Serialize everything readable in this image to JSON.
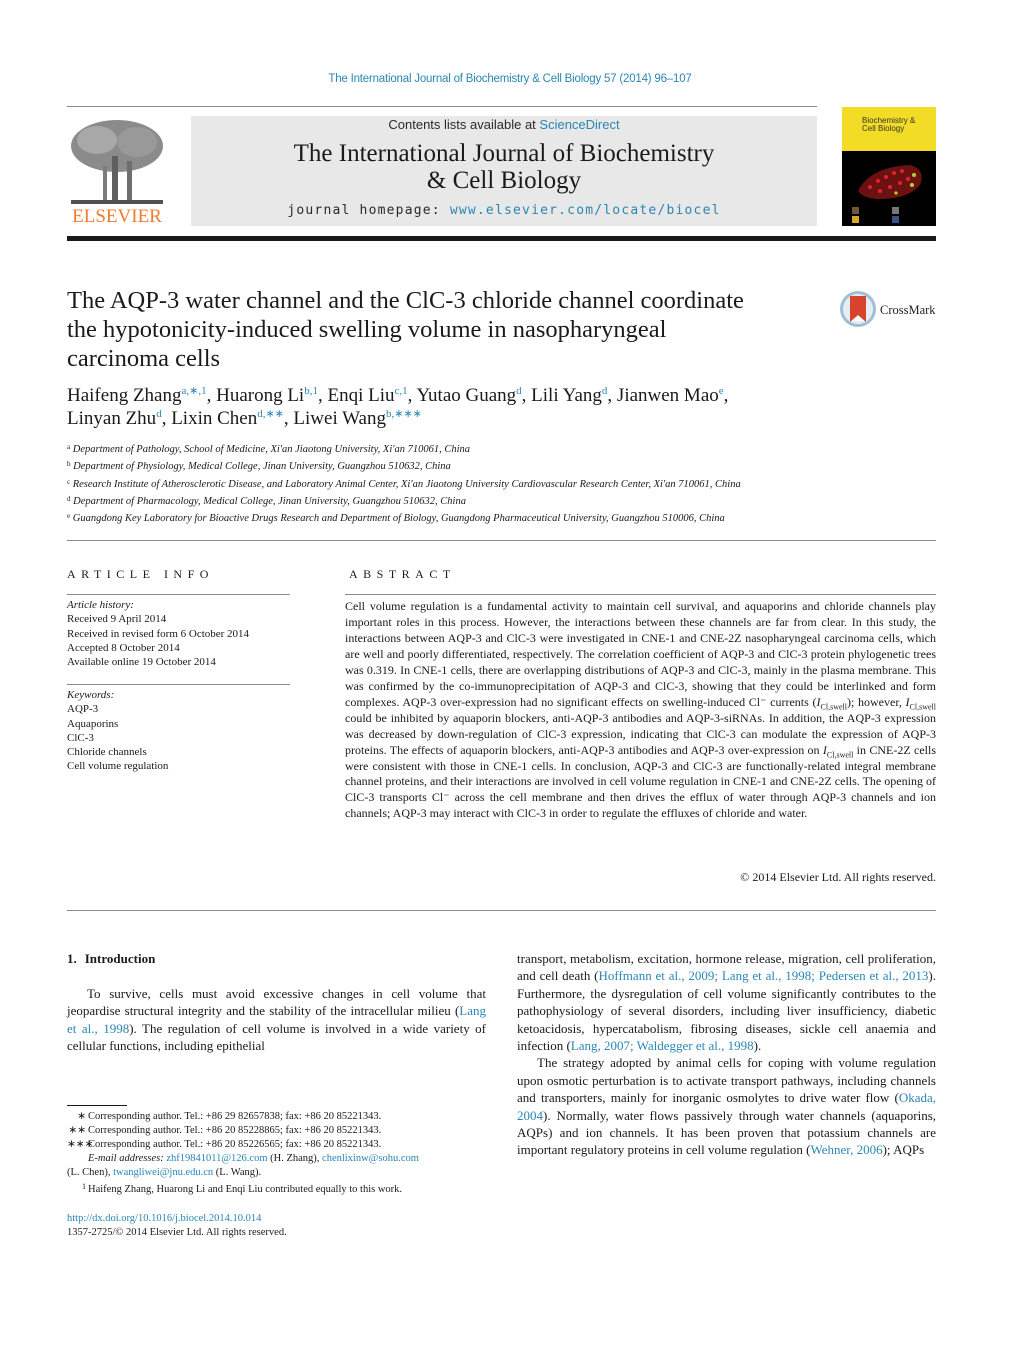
{
  "running_head": "The International Journal of Biochemistry & Cell Biology 57 (2014) 96–107",
  "publisher": {
    "logo_icon": "elsevier-tree-icon",
    "name": "ELSEVIER",
    "color": "#f07c2a"
  },
  "masthead": {
    "contents_prefix": "Contents lists available at ",
    "contents_link": "ScienceDirect",
    "journal_title_line1": "The International Journal of Biochemistry",
    "journal_title_line2": "& Cell Biology",
    "homepage_prefix": "journal homepage: ",
    "homepage_link": "www.elsevier.com/locate/biocel"
  },
  "cover": {
    "line1": "Biochemistry &",
    "line2": "Cell Biology"
  },
  "crossmark": {
    "label": "CrossMark"
  },
  "article": {
    "title_line1": "The AQP-3 water channel and the ClC-3 chloride channel coordinate",
    "title_line2": "the hypotonicity-induced swelling volume in nasopharyngeal",
    "title_line3": "carcinoma cells",
    "authors": [
      {
        "name": "Haifeng Zhang",
        "marks": "a,∗,1",
        "sep": ", "
      },
      {
        "name": "Huarong Li",
        "marks": "b,1",
        "sep": ", "
      },
      {
        "name": "Enqi Liu",
        "marks": "c,1",
        "sep": ", "
      },
      {
        "name": "Yutao Guang",
        "marks": "d",
        "sep": ", "
      },
      {
        "name": "Lili Yang",
        "marks": "d",
        "sep": ", "
      },
      {
        "name": "Jianwen Mao",
        "marks": "e",
        "sep": ","
      },
      {
        "name": "Linyan Zhu",
        "marks": "d",
        "sep": ", "
      },
      {
        "name": "Lixin Chen",
        "marks": "d,∗∗",
        "sep": ", "
      },
      {
        "name": "Liwei Wang",
        "marks": "b,∗∗∗",
        "sep": ""
      }
    ],
    "affiliations": [
      {
        "key": "a",
        "text": "Department of Pathology, School of Medicine, Xi'an Jiaotong University, Xi'an 710061, China"
      },
      {
        "key": "b",
        "text": "Department of Physiology, Medical College, Jinan University, Guangzhou 510632, China"
      },
      {
        "key": "c",
        "text": "Research Institute of Atherosclerotic Disease, and Laboratory Animal Center, Xi'an Jiaotong University Cardiovascular Research Center, Xi'an 710061, China"
      },
      {
        "key": "d",
        "text": "Department of Pharmacology, Medical College, Jinan University, Guangzhou 510632, China"
      },
      {
        "key": "e",
        "text": "Guangdong Key Laboratory for Bioactive Drugs Research and Department of Biology, Guangdong Pharmaceutical University, Guangzhou 510006, China"
      }
    ]
  },
  "article_info": {
    "heading": "ARTICLE INFO",
    "history_label": "Article history:",
    "history": [
      "Received 9 April 2014",
      "Received in revised form 6 October 2014",
      "Accepted 8 October 2014",
      "Available online 19 October 2014"
    ],
    "keywords_label": "Keywords:",
    "keywords": [
      "AQP-3",
      "Aquaporins",
      "ClC-3",
      "Chloride channels",
      "Cell volume regulation"
    ]
  },
  "abstract": {
    "heading": "ABSTRACT",
    "part1": "Cell volume regulation is a fundamental activity to maintain cell survival, and aquaporins and chloride channels play important roles in this process. However, the interactions between these channels are far from clear. In this study, the interactions between AQP-3 and ClC-3 were investigated in CNE-1 and CNE-2Z nasopharyngeal carcinoma cells, which are well and poorly differentiated, respectively. The correlation coefficient of AQP-3 and ClC-3 protein phylogenetic trees was 0.319. In CNE-1 cells, there are overlapping distributions of AQP-3 and ClC-3, mainly in the plasma membrane. This was confirmed by the co-immunoprecipitation of AQP-3 and ClC-3, showing that they could be interlinked and form complexes. AQP-3 over-expression had no significant effects on swelling-induced Cl⁻ currents (",
    "icl": "I",
    "icl_sub": "Cl,swell",
    "part2": "); however, ",
    "part3": " could be inhibited by aquaporin blockers, anti-AQP-3 antibodies and AQP-3-siRNAs. In addition, the AQP-3 expression was decreased by down-regulation of ClC-3 expression, indicating that ClC-3 can modulate the expression of AQP-3 proteins. The effects of aquaporin blockers, anti-AQP-3 antibodies and AQP-3 over-expression on ",
    "part4": " in CNE-2Z cells were consistent with those in CNE-1 cells. In conclusion, AQP-3 and ClC-3 are functionally-related integral membrane channel proteins, and their interactions are involved in cell volume regulation in CNE-1 and CNE-2Z cells. The opening of ClC-3 transports Cl⁻ across the cell membrane and then drives the efflux of water through AQP-3 channels and ion channels; AQP-3 may interact with ClC-3 in order to regulate the effluxes of chloride and water.",
    "copyright": "© 2014 Elsevier Ltd. All rights reserved."
  },
  "introduction": {
    "number": "1.",
    "heading": "Introduction",
    "left_p1_a": "To survive, cells must avoid excessive changes in cell volume that jeopardise structural integrity and the stability of the intracellular milieu (",
    "left_p1_cite": "Lang et al., 1998",
    "left_p1_b": "). The regulation of cell volume is involved in a wide variety of cellular functions, including epithelial",
    "right_p1_a": "transport, metabolism, excitation, hormone release, migration, cell proliferation, and cell death (",
    "right_p1_cite": "Hoffmann et al., 2009; Lang et al., 1998; Pedersen et al., 2013",
    "right_p1_b": "). Furthermore, the dysregulation of cell volume significantly contributes to the pathophysiology of several disorders, including liver insufficiency, diabetic ketoacidosis, hypercatabolism, fibrosing diseases, sickle cell anaemia and infection (",
    "right_p1_cite2": "Lang, 2007; Waldegger et al., 1998",
    "right_p1_c": ").",
    "right_p2_a": "The strategy adopted by animal cells for coping with volume regulation upon osmotic perturbation is to activate transport pathways, including channels and transporters, mainly for inorganic osmolytes to drive water flow (",
    "right_p2_cite": "Okada, 2004",
    "right_p2_b": "). Normally, water flows passively through water channels (aquaporins, AQPs) and ion channels. It has been proven that potassium channels are important regulatory proteins in cell volume regulation (",
    "right_p2_cite2": "Wehner, 2006",
    "right_p2_c": "); AQPs"
  },
  "footnotes": {
    "items": [
      {
        "mark": "∗",
        "text": "Corresponding author. Tel.: +86 29 82657838; fax: +86 20 85221343."
      },
      {
        "mark": "∗∗",
        "text": "Corresponding author. Tel.: +86 20 85228865; fax: +86 20 85221343."
      },
      {
        "mark": "∗∗∗",
        "text": "Corresponding author. Tel.: +86 20 85226565; fax: +86 20 85221343."
      }
    ],
    "email_label": "E-mail addresses:",
    "email1": "zhf19841011@126.com",
    "email1_who": " (H. Zhang), ",
    "email2": "chenlixinw@sohu.com",
    "email2_who": "(L. Chen), ",
    "email3": "twangliwei@jnu.edu.cn",
    "email3_who": " (L. Wang).",
    "equal_mark": "1",
    "equal_text": "Haifeng Zhang, Huarong Li and Enqi Liu contributed equally to this work."
  },
  "doi": {
    "link": "http://dx.doi.org/10.1016/j.biocel.2014.10.014",
    "issn": "1357-2725/© 2014 Elsevier Ltd. All rights reserved."
  },
  "colors": {
    "link": "#2a86b4",
    "masthead_bg": "#e8e8e8",
    "cover_band": "#f2dc26"
  }
}
